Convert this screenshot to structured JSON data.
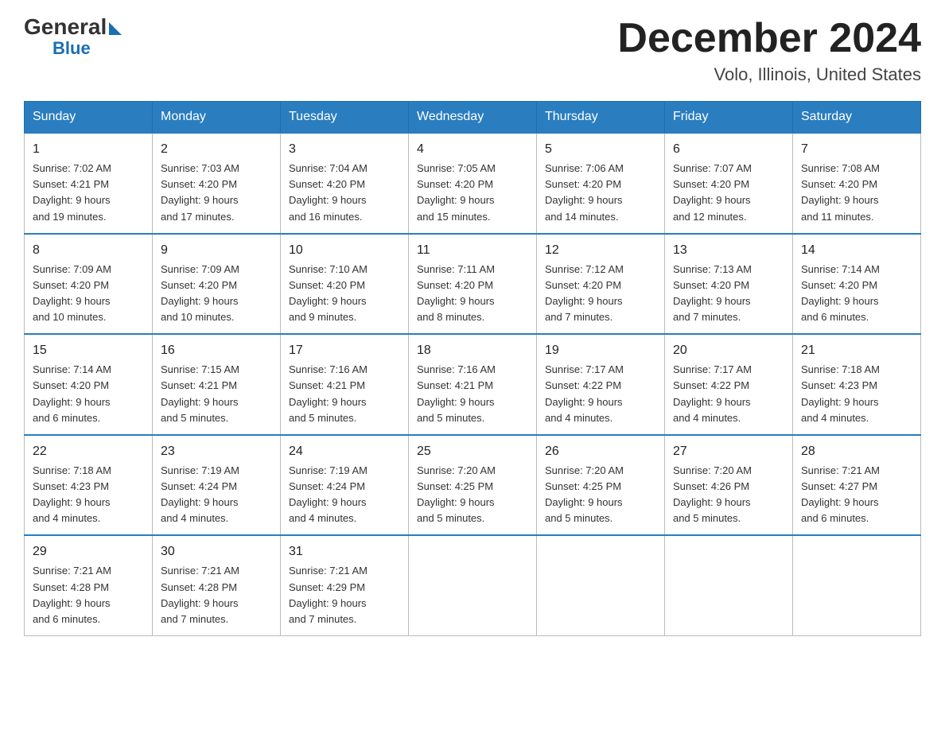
{
  "logo": {
    "general": "General",
    "blue": "Blue",
    "arrow_char": "▶"
  },
  "header": {
    "month": "December 2024",
    "location": "Volo, Illinois, United States"
  },
  "days_of_week": [
    "Sunday",
    "Monday",
    "Tuesday",
    "Wednesday",
    "Thursday",
    "Friday",
    "Saturday"
  ],
  "weeks": [
    [
      {
        "day": "1",
        "sunrise": "7:02 AM",
        "sunset": "4:21 PM",
        "daylight": "9 hours and 19 minutes."
      },
      {
        "day": "2",
        "sunrise": "7:03 AM",
        "sunset": "4:20 PM",
        "daylight": "9 hours and 17 minutes."
      },
      {
        "day": "3",
        "sunrise": "7:04 AM",
        "sunset": "4:20 PM",
        "daylight": "9 hours and 16 minutes."
      },
      {
        "day": "4",
        "sunrise": "7:05 AM",
        "sunset": "4:20 PM",
        "daylight": "9 hours and 15 minutes."
      },
      {
        "day": "5",
        "sunrise": "7:06 AM",
        "sunset": "4:20 PM",
        "daylight": "9 hours and 14 minutes."
      },
      {
        "day": "6",
        "sunrise": "7:07 AM",
        "sunset": "4:20 PM",
        "daylight": "9 hours and 12 minutes."
      },
      {
        "day": "7",
        "sunrise": "7:08 AM",
        "sunset": "4:20 PM",
        "daylight": "9 hours and 11 minutes."
      }
    ],
    [
      {
        "day": "8",
        "sunrise": "7:09 AM",
        "sunset": "4:20 PM",
        "daylight": "9 hours and 10 minutes."
      },
      {
        "day": "9",
        "sunrise": "7:09 AM",
        "sunset": "4:20 PM",
        "daylight": "9 hours and 10 minutes."
      },
      {
        "day": "10",
        "sunrise": "7:10 AM",
        "sunset": "4:20 PM",
        "daylight": "9 hours and 9 minutes."
      },
      {
        "day": "11",
        "sunrise": "7:11 AM",
        "sunset": "4:20 PM",
        "daylight": "9 hours and 8 minutes."
      },
      {
        "day": "12",
        "sunrise": "7:12 AM",
        "sunset": "4:20 PM",
        "daylight": "9 hours and 7 minutes."
      },
      {
        "day": "13",
        "sunrise": "7:13 AM",
        "sunset": "4:20 PM",
        "daylight": "9 hours and 7 minutes."
      },
      {
        "day": "14",
        "sunrise": "7:14 AM",
        "sunset": "4:20 PM",
        "daylight": "9 hours and 6 minutes."
      }
    ],
    [
      {
        "day": "15",
        "sunrise": "7:14 AM",
        "sunset": "4:20 PM",
        "daylight": "9 hours and 6 minutes."
      },
      {
        "day": "16",
        "sunrise": "7:15 AM",
        "sunset": "4:21 PM",
        "daylight": "9 hours and 5 minutes."
      },
      {
        "day": "17",
        "sunrise": "7:16 AM",
        "sunset": "4:21 PM",
        "daylight": "9 hours and 5 minutes."
      },
      {
        "day": "18",
        "sunrise": "7:16 AM",
        "sunset": "4:21 PM",
        "daylight": "9 hours and 5 minutes."
      },
      {
        "day": "19",
        "sunrise": "7:17 AM",
        "sunset": "4:22 PM",
        "daylight": "9 hours and 4 minutes."
      },
      {
        "day": "20",
        "sunrise": "7:17 AM",
        "sunset": "4:22 PM",
        "daylight": "9 hours and 4 minutes."
      },
      {
        "day": "21",
        "sunrise": "7:18 AM",
        "sunset": "4:23 PM",
        "daylight": "9 hours and 4 minutes."
      }
    ],
    [
      {
        "day": "22",
        "sunrise": "7:18 AM",
        "sunset": "4:23 PM",
        "daylight": "9 hours and 4 minutes."
      },
      {
        "day": "23",
        "sunrise": "7:19 AM",
        "sunset": "4:24 PM",
        "daylight": "9 hours and 4 minutes."
      },
      {
        "day": "24",
        "sunrise": "7:19 AM",
        "sunset": "4:24 PM",
        "daylight": "9 hours and 4 minutes."
      },
      {
        "day": "25",
        "sunrise": "7:20 AM",
        "sunset": "4:25 PM",
        "daylight": "9 hours and 5 minutes."
      },
      {
        "day": "26",
        "sunrise": "7:20 AM",
        "sunset": "4:25 PM",
        "daylight": "9 hours and 5 minutes."
      },
      {
        "day": "27",
        "sunrise": "7:20 AM",
        "sunset": "4:26 PM",
        "daylight": "9 hours and 5 minutes."
      },
      {
        "day": "28",
        "sunrise": "7:21 AM",
        "sunset": "4:27 PM",
        "daylight": "9 hours and 6 minutes."
      }
    ],
    [
      {
        "day": "29",
        "sunrise": "7:21 AM",
        "sunset": "4:28 PM",
        "daylight": "9 hours and 6 minutes."
      },
      {
        "day": "30",
        "sunrise": "7:21 AM",
        "sunset": "4:28 PM",
        "daylight": "9 hours and 7 minutes."
      },
      {
        "day": "31",
        "sunrise": "7:21 AM",
        "sunset": "4:29 PM",
        "daylight": "9 hours and 7 minutes."
      },
      null,
      null,
      null,
      null
    ]
  ],
  "labels": {
    "sunrise": "Sunrise: ",
    "sunset": "Sunset: ",
    "daylight": "Daylight: "
  }
}
